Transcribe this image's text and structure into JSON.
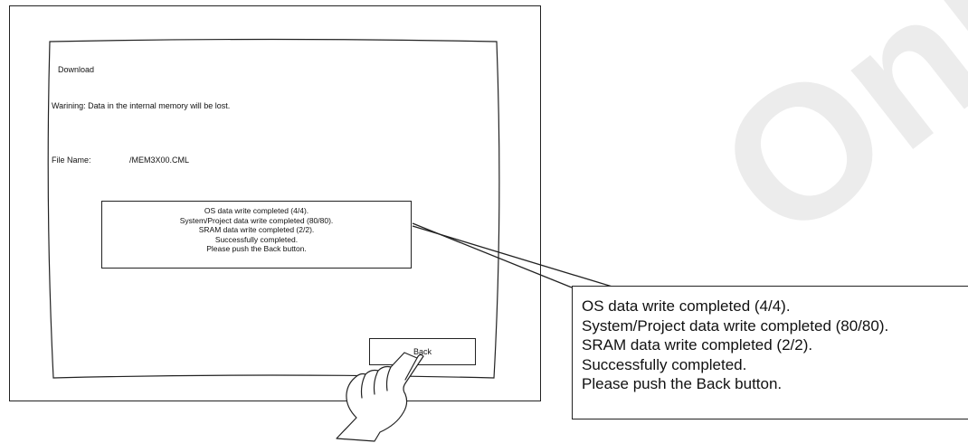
{
  "screen": {
    "title": "Download",
    "warning": "Warining: Data in the internal memory will be lost.",
    "file_label": "File Name:",
    "file_value": "/MEM3X00.CML",
    "messages": [
      "OS data write completed (4/4).",
      "System/Project data write completed (80/80).",
      "SRAM data write completed (2/2).",
      "Successfully completed.",
      "Please push the Back button."
    ],
    "back_label": "Back"
  },
  "callout": {
    "lines": [
      "OS data write completed (4/4).",
      "System/Project data write completed (80/80).",
      "SRAM data write completed (2/2).",
      "Successfully completed.",
      "Please push the Back button."
    ]
  },
  "watermark": "Only",
  "icons": [
    "pointing-hand-icon"
  ]
}
